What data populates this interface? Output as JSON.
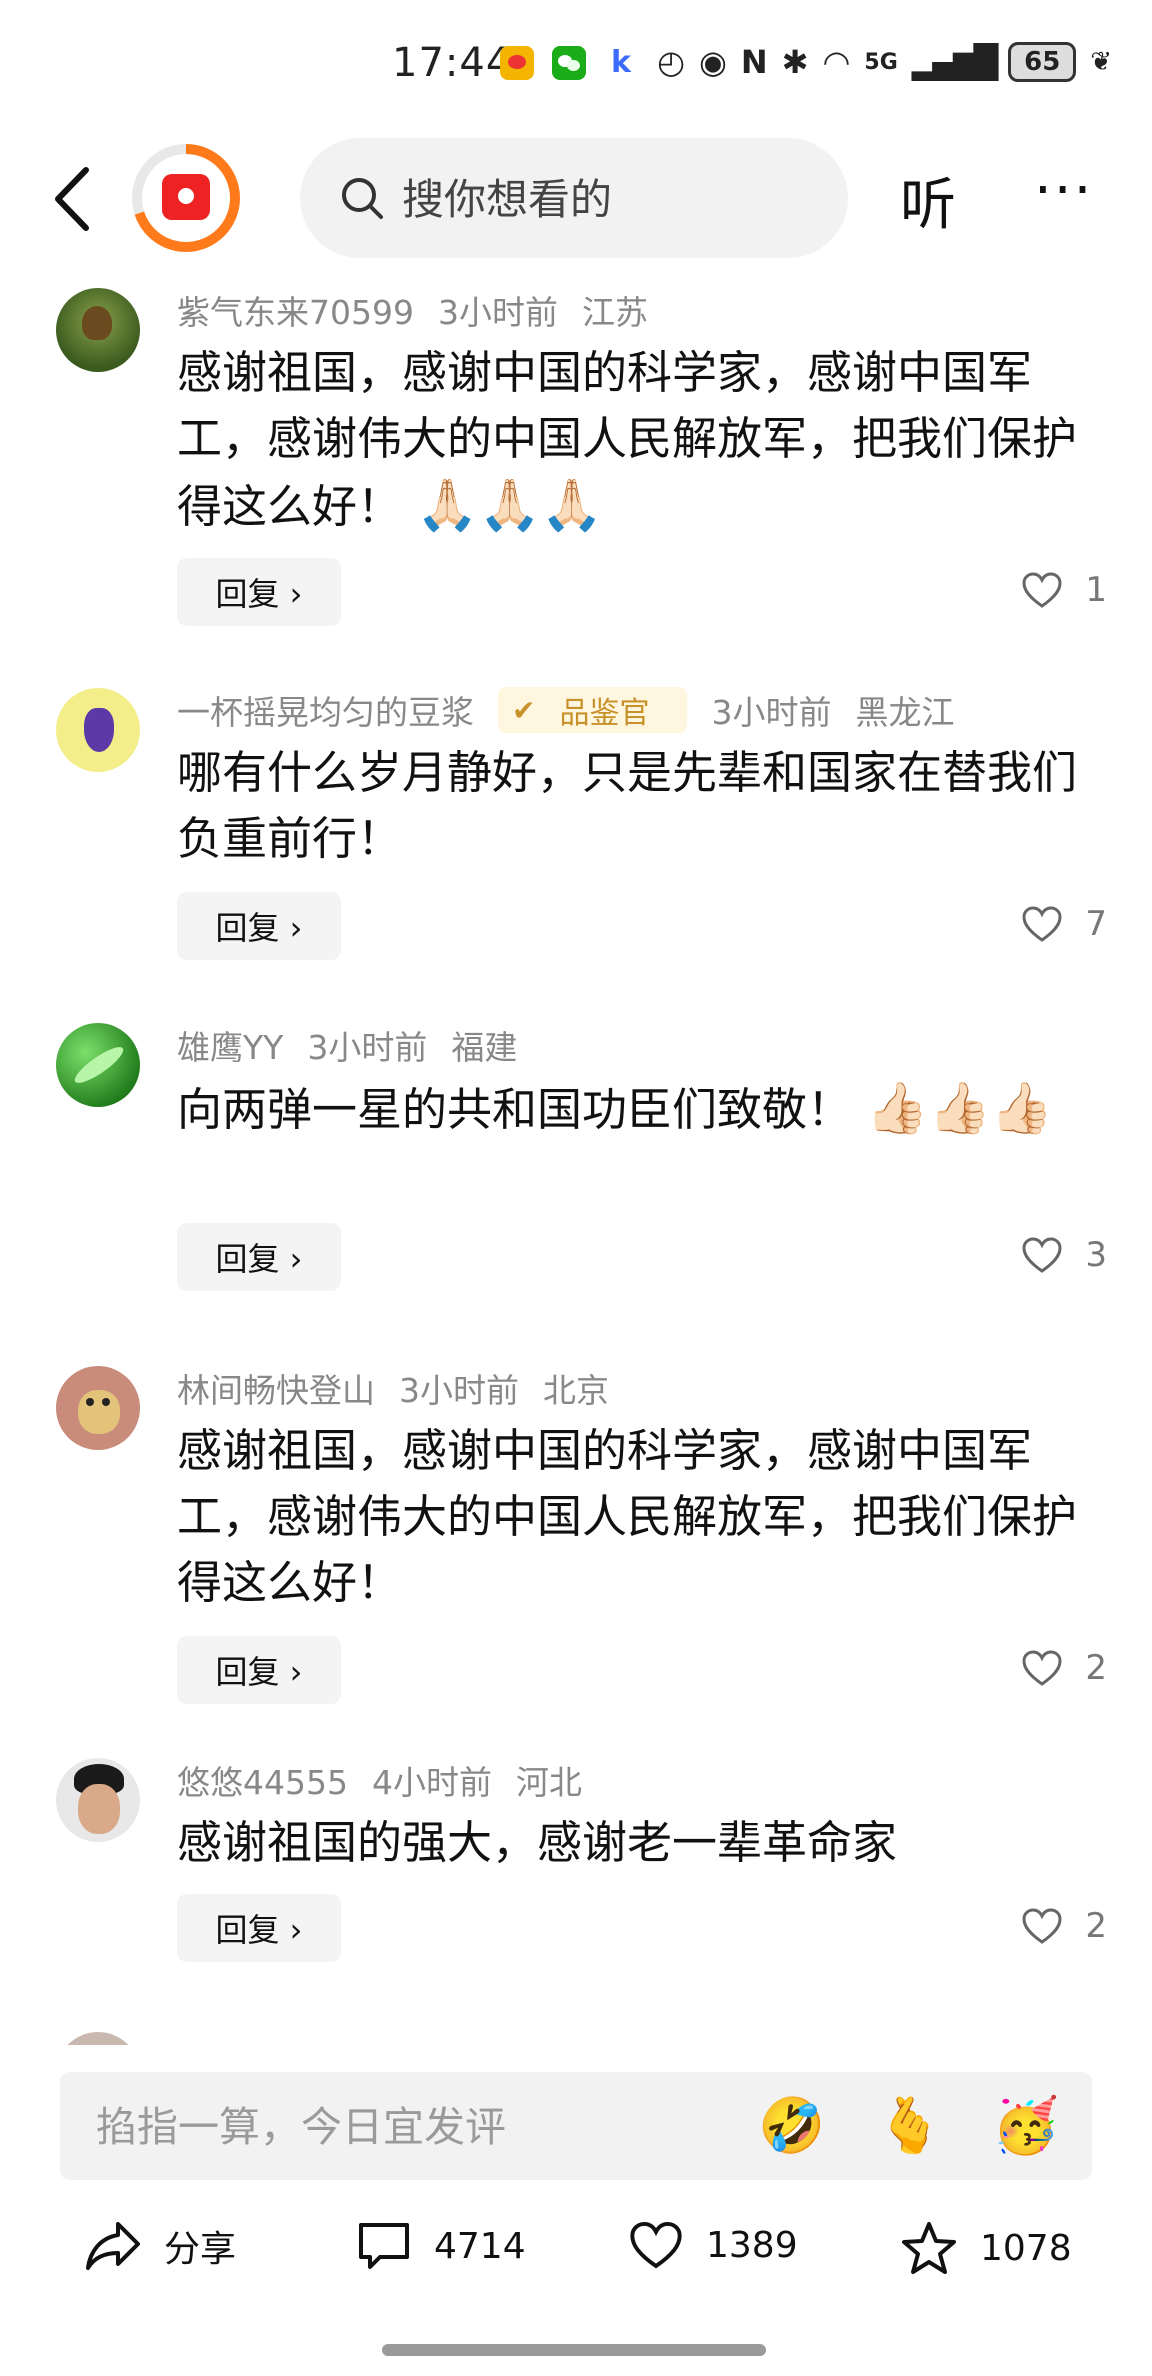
{
  "status_bar": {
    "time": "17:44",
    "network": "5G",
    "battery": "65",
    "colors": {
      "weibo": "#f5b400",
      "wechat": "#1aad19",
      "k_app": "#3b6cff"
    }
  },
  "header": {
    "search_placeholder": "搜你想看的",
    "listen_label": "听",
    "more_label": "···"
  },
  "comments": [
    {
      "user": "紫气东来70599",
      "time": "3小时前",
      "location": "江苏",
      "badge": "",
      "text": "感谢祖国，感谢中国的科学家，感谢中国军工，感谢伟大的中国人民解放军，把我们保护得这么好！",
      "emoji": "🙏🏻🙏🏻🙏🏻",
      "reply_label": "回复 ›",
      "likes": "1"
    },
    {
      "user": "一杯摇晃均匀的豆浆",
      "time": "3小时前",
      "location": "黑龙江",
      "badge": "品鉴官",
      "text": "哪有什么岁月静好，只是先辈和国家在替我们负重前行！",
      "emoji": "",
      "reply_label": "回复 ›",
      "likes": "7"
    },
    {
      "user": "雄鹰YY",
      "time": "3小时前",
      "location": "福建",
      "badge": "",
      "text": "向两弹一星的共和国功臣们致敬！",
      "emoji": "👍🏻👍🏻👍🏻",
      "reply_label": "回复 ›",
      "likes": "3"
    },
    {
      "user": "林间畅快登山",
      "time": "3小时前",
      "location": "北京",
      "badge": "",
      "text": "感谢祖国，感谢中国的科学家，感谢中国军工，感谢伟大的中国人民解放军，把我们保护得这么好！",
      "emoji": "",
      "reply_label": "回复 ›",
      "likes": "2"
    },
    {
      "user": "悠悠44555",
      "time": "4小时前",
      "location": "河北",
      "badge": "",
      "text": "感谢祖国的强大，感谢老一辈革命家",
      "emoji": "",
      "reply_label": "回复 ›",
      "likes": "2"
    }
  ],
  "composer": {
    "placeholder": "掐指一算，今日宜发评",
    "emojis": [
      "🤣",
      "🫰",
      "🥳"
    ]
  },
  "bottom_bar": {
    "share_label": "分享",
    "comments_count": "4714",
    "likes_count": "1389",
    "favorites_count": "1078"
  }
}
